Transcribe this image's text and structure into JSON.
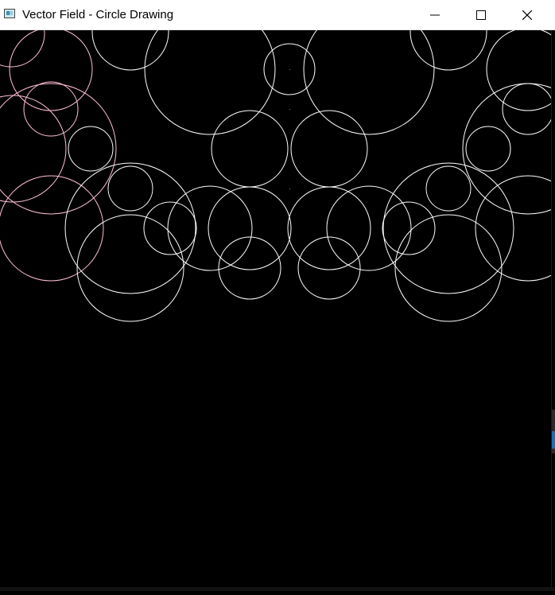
{
  "window": {
    "title": "Vector Field - Circle Drawing",
    "icon": "app-window-icon",
    "controls": {
      "minimize": "minimize-icon",
      "maximize": "maximize-icon",
      "close": "close-icon"
    }
  },
  "canvas": {
    "background": "#000000",
    "stroke_colors": {
      "white": "#ffffff",
      "pink": "#ffc0d8"
    }
  }
}
